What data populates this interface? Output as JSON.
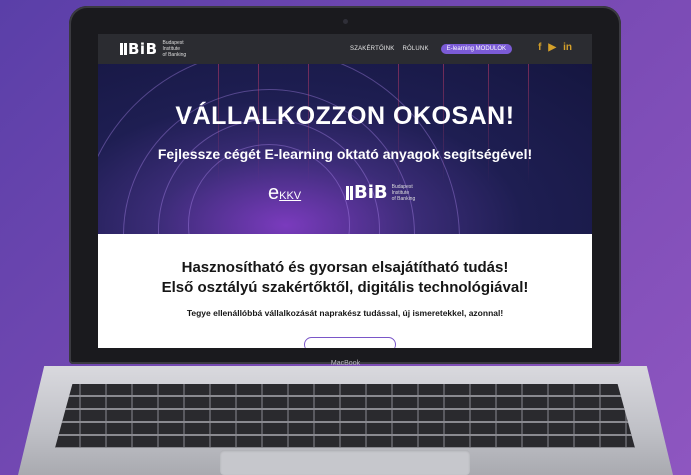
{
  "navbar": {
    "logo_mark": "BiB",
    "logo_sub": [
      "Budapest",
      "Institute",
      "of Banking"
    ],
    "links": [
      "SZAKÉRTŐINK",
      "RÓLUNK"
    ],
    "cta_pill": "E-learning MODULOK",
    "social_icons": [
      "facebook-icon",
      "youtube-icon",
      "linkedin-icon"
    ],
    "social_glyphs": [
      "f",
      "▶",
      "in"
    ]
  },
  "hero": {
    "title": "VÁLLALKOZZON OKOSAN!",
    "subtitle": "Fejlessze cégét E-learning oktató anyagok segítségével!",
    "partner_ekkv": "e",
    "partner_ekkv_suffix": "KKV",
    "partner_bib": "BiB",
    "partner_bib_sub": [
      "Budapest",
      "Institute",
      "of Banking"
    ]
  },
  "content": {
    "heading_line1": "Hasznosítható és gyorsan elsajátítható tudás!",
    "heading_line2": "Első osztályú szakértőktől, digitális technológiával!",
    "tagline": "Tegye ellenállóbbá vállalkozását naprakész tudással, új ismeretekkel, azonnal!"
  },
  "device": {
    "label": "MacBook"
  },
  "colors": {
    "background": "#7a4bb5",
    "accent": "#7b5bd6",
    "social": "#d4a02a"
  }
}
